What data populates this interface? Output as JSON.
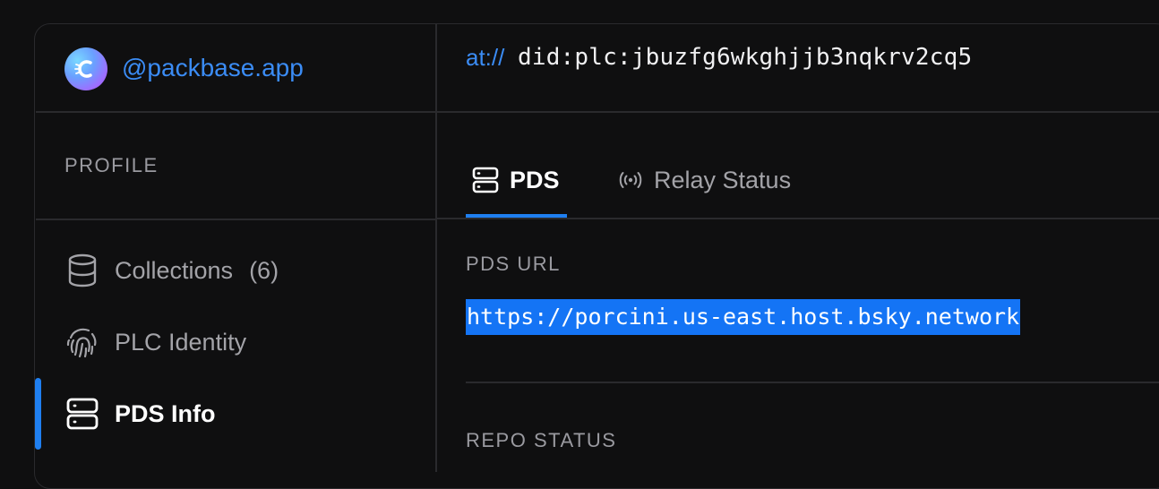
{
  "header": {
    "handle": "@packbase.app",
    "at_prefix": "at://",
    "did": "did:plc:jbuzfg6wkghjjb3nqkrv2cq5"
  },
  "sidebar": {
    "section_label": "PROFILE",
    "items": [
      {
        "label": "Collections",
        "count": "(6)",
        "icon": "database-icon"
      },
      {
        "label": "PLC Identity",
        "icon": "fingerprint-icon"
      },
      {
        "label": "PDS Info",
        "icon": "server-icon",
        "active": true
      }
    ]
  },
  "tabs": [
    {
      "label": "PDS",
      "icon": "server-icon",
      "active": true
    },
    {
      "label": "Relay Status",
      "icon": "broadcast-icon"
    }
  ],
  "content": {
    "pds_url_label": "PDS URL",
    "pds_url": "https://porcini.us-east.host.bsky.network",
    "repo_status_label": "REPO STATUS"
  },
  "colors": {
    "accent": "#1f7ff0",
    "link": "#3b8cf5",
    "selection": "#1474f5",
    "background": "#0f0f10"
  }
}
